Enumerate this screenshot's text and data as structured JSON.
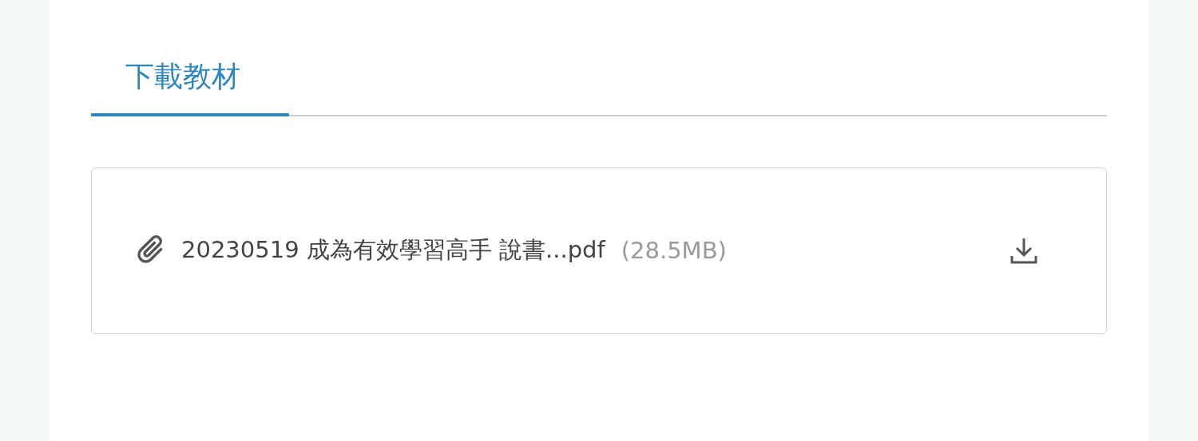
{
  "tabs": [
    {
      "label": "下載教材",
      "selected": true
    }
  ],
  "files": [
    {
      "name": "20230519 成為有效學習高手 說書...pdf",
      "size": "(28.5MB)"
    }
  ]
}
